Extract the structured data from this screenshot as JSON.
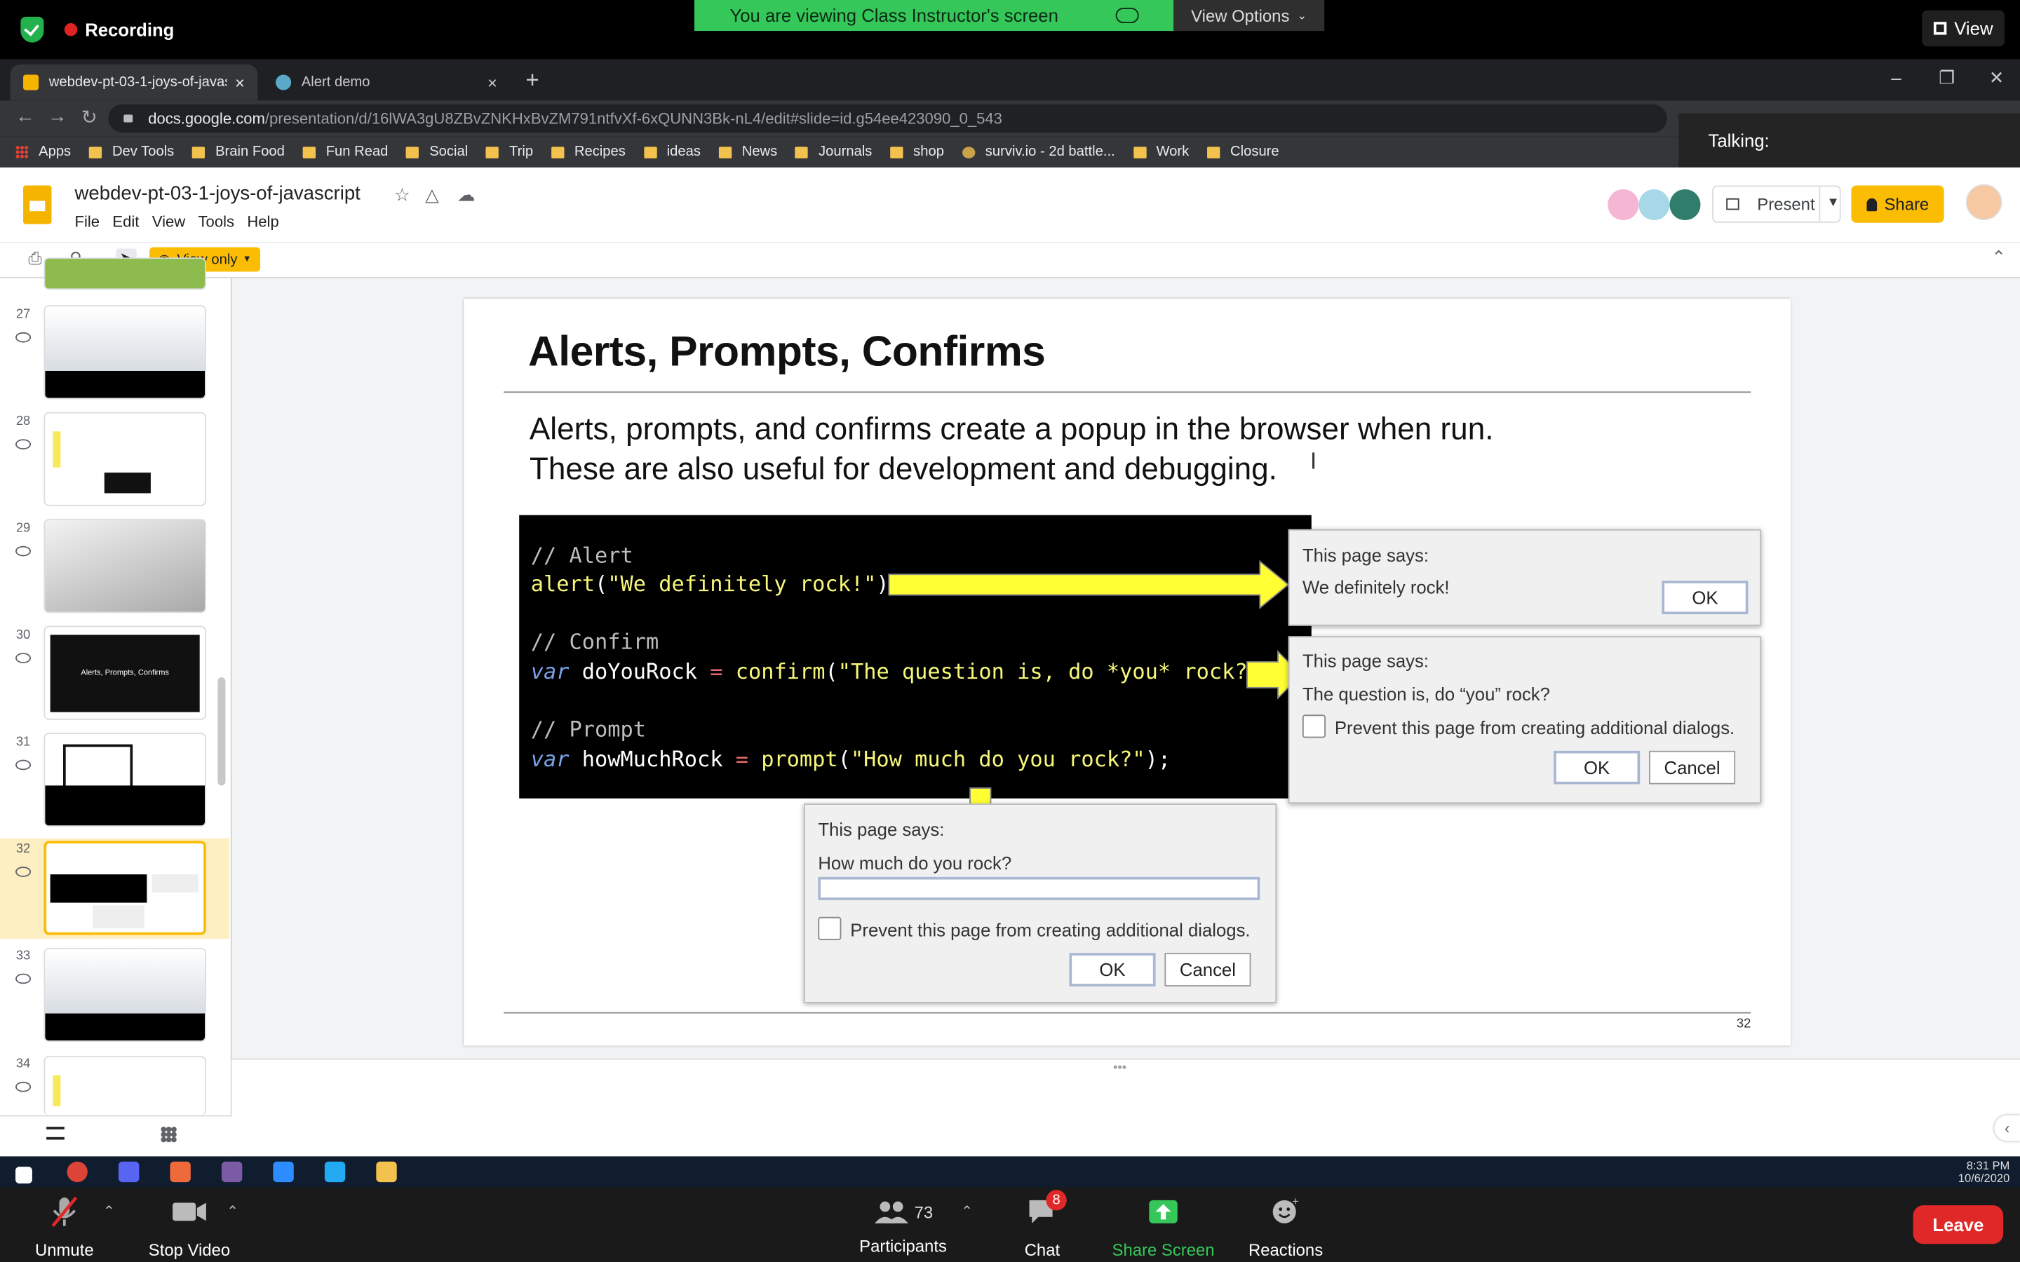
{
  "zoom": {
    "recording_label": "Recording",
    "viewing_banner": "You are viewing Class Instructor's screen",
    "view_options_label": "View Options",
    "view_label": "View",
    "talking_label": "Talking:",
    "bottom": {
      "unmute": "Unmute",
      "stop_video": "Stop Video",
      "participants": "Participants",
      "participants_count": "73",
      "chat": "Chat",
      "chat_badge": "8",
      "share_screen": "Share Screen",
      "reactions": "Reactions",
      "leave": "Leave"
    },
    "colors": {
      "banner": "#35c759",
      "leave": "#e02828",
      "share": "#35c759"
    }
  },
  "browser": {
    "tabs": [
      {
        "title": "webdev-pt-03-1-joys-of-javascript"
      },
      {
        "title": "Alert demo"
      }
    ],
    "url_host": "docs.google.com",
    "url_path": "/presentation/d/16lWA3gU8ZBvZNKHxBvZM791ntfvXf-6xQUNN3Bk-nL4/edit#slide=id.g54ee423090_0_543",
    "bookmarks": [
      "Apps",
      "Dev Tools",
      "Brain Food",
      "Fun Read",
      "Social",
      "Trip",
      "Recipes",
      "ideas",
      "News",
      "Journals",
      "shop",
      "surviv.io - 2d battle...",
      "Work",
      "Closure"
    ]
  },
  "slides_app": {
    "doc_title": "webdev-pt-03-1-joys-of-javascript",
    "menu": [
      "File",
      "Edit",
      "View",
      "Tools",
      "Help"
    ],
    "present_label": "Present",
    "share_label": "Share",
    "view_only_label": "View only",
    "brand_color": "#fbbc04",
    "thumbnails": [
      {
        "num": "27"
      },
      {
        "num": "28"
      },
      {
        "num": "29"
      },
      {
        "num": "30",
        "title": "Alerts, Prompts, Confirms"
      },
      {
        "num": "31"
      },
      {
        "num": "32"
      },
      {
        "num": "33"
      },
      {
        "num": "34"
      }
    ]
  },
  "slide": {
    "title": "Alerts, Prompts, Confirms",
    "body_line1": "Alerts, prompts, and confirms create a popup in the browser when run.",
    "body_line2": "These are also useful for development and debugging.",
    "code": {
      "c1": "// Alert",
      "alert_fn": "alert",
      "alert_str": "\"We definitely rock!\"",
      "c2": "// Confirm",
      "var1": "var",
      "var1_name": " doYouRock ",
      "confirm_fn": "confirm",
      "confirm_str": "\"The question is, do *you* rock?\"",
      "c3": "// Prompt",
      "var2": "var",
      "var2_name": " howMuchRock ",
      "prompt_fn": "prompt",
      "prompt_str": "\"How much do you rock?\""
    },
    "alert_dialog": {
      "header": "This page says:",
      "message": "We definitely rock!",
      "ok": "OK"
    },
    "confirm_dialog": {
      "header": "This page says:",
      "message": "The question is, do “you” rock?",
      "checkbox": "Prevent this page from creating additional dialogs.",
      "ok": "OK",
      "cancel": "Cancel"
    },
    "prompt_dialog": {
      "header": "This page says:",
      "message": "How much do you rock?",
      "checkbox": "Prevent this page from creating additional dialogs.",
      "ok": "OK",
      "cancel": "Cancel"
    },
    "page_number": "32"
  },
  "taskbar": {
    "time": "8:31 PM",
    "date": "10/6/2020"
  }
}
